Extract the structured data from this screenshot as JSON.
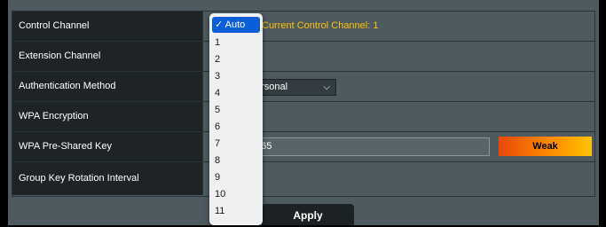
{
  "settings": {
    "rows": [
      {
        "label": "Control Channel"
      },
      {
        "label": "Extension Channel"
      },
      {
        "label": "Authentication Method"
      },
      {
        "label": "WPA Encryption"
      },
      {
        "label": "WPA Pre-Shared Key"
      },
      {
        "label": "Group Key Rotation Interval"
      }
    ],
    "current_channel_text": "Current Control Channel: 1",
    "auth_method_value": "ersonal",
    "psk_value": "365",
    "strength_label": "Weak"
  },
  "channel_dropdown": {
    "options": [
      "✓ Auto",
      "1",
      "2",
      "3",
      "4",
      "5",
      "6",
      "7",
      "8",
      "9",
      "10",
      "11"
    ]
  },
  "apply_label": "Apply",
  "colors": {
    "accent_text": "#ffc107",
    "selected_option": "#0a5ed7"
  }
}
